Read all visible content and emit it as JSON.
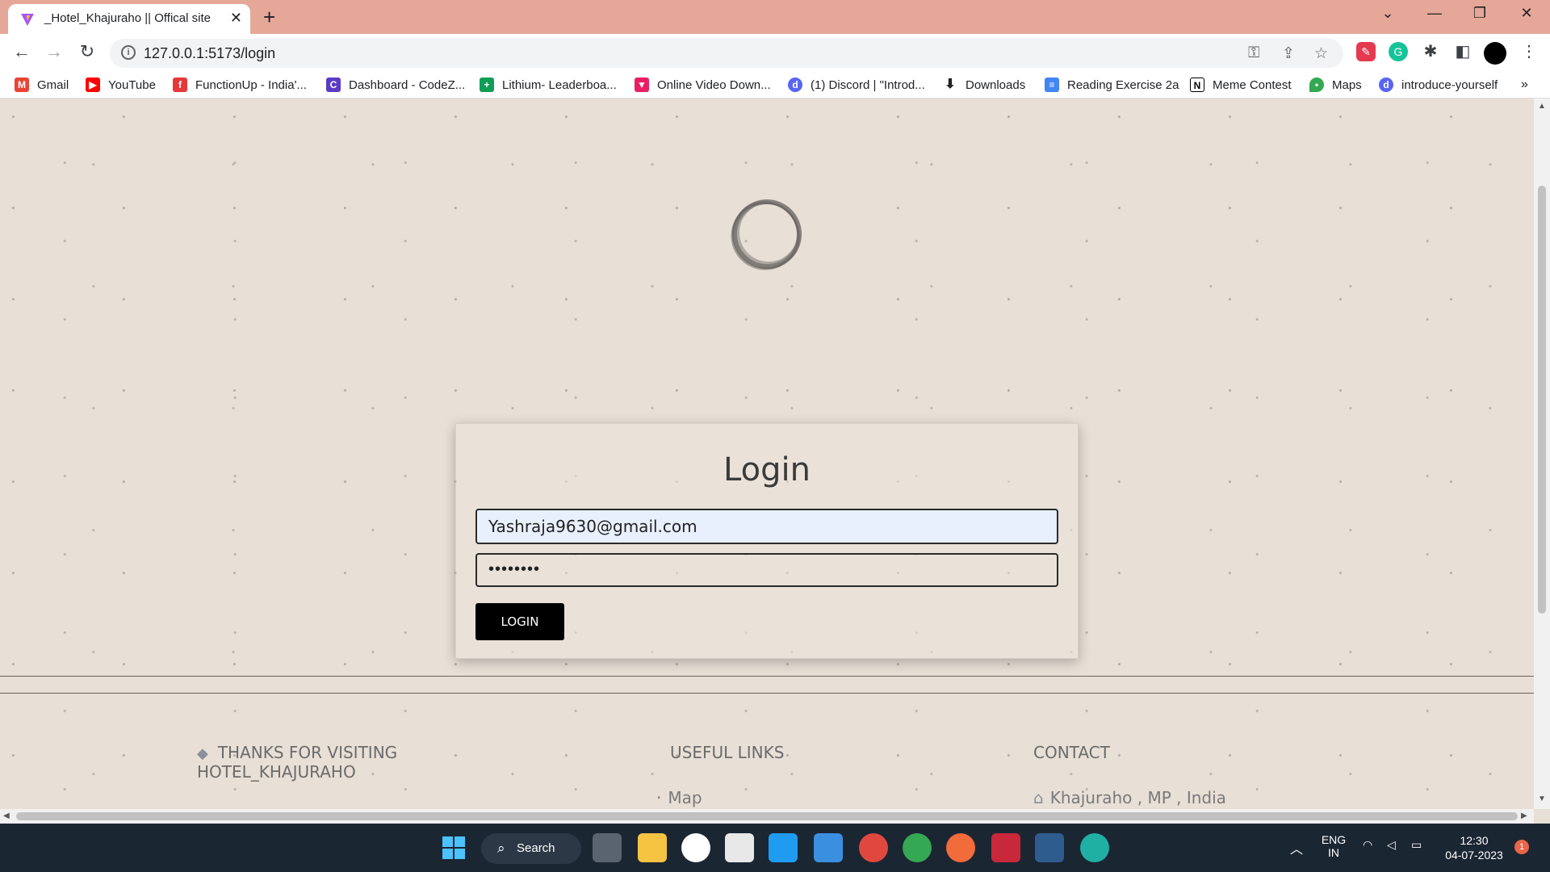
{
  "tab": {
    "title": "_Hotel_Khajuraho || Offical site"
  },
  "address_bar": {
    "url": "127.0.0.1:5173/login"
  },
  "bookmarks": [
    {
      "label": "Gmail",
      "icon": "gmail-icon",
      "color": "#ea4335"
    },
    {
      "label": "YouTube",
      "icon": "youtube-icon",
      "color": "#ff0000"
    },
    {
      "label": "FunctionUp - India'...",
      "icon": "functionup-icon",
      "color": "#e5383b"
    },
    {
      "label": "Dashboard - CodeZ...",
      "icon": "codez-icon",
      "color": "#5b3cc4"
    },
    {
      "label": "Lithium- Leaderboa...",
      "icon": "sheets-icon",
      "color": "#0f9d58"
    },
    {
      "label": "Online Video Down...",
      "icon": "video-icon",
      "color": "#e91e63"
    },
    {
      "label": "(1) Discord | \"Introd...",
      "icon": "discord-icon",
      "color": "#5865f2"
    },
    {
      "label": "Downloads",
      "icon": "download-icon",
      "color": "#202124"
    },
    {
      "label": "Reading Exercise 2a",
      "icon": "docs-icon",
      "color": "#4285f4"
    },
    {
      "label": "Meme Contest",
      "icon": "notion-icon",
      "color": "#000000"
    },
    {
      "label": "Maps",
      "icon": "maps-icon",
      "color": "#34a853"
    },
    {
      "label": "introduce-yourself",
      "icon": "discord-icon",
      "color": "#5865f2"
    }
  ],
  "login": {
    "title": "Login",
    "email_value": "Yashraja9630@gmail.com",
    "password_value": "••••••••",
    "button_label": "LOGIN"
  },
  "footer": {
    "thanks_line1": "THANKS FOR VISITING",
    "thanks_line2": "HOTEL_KHAJURAHO",
    "useful_links_title": "USEFUL LINKS",
    "useful_link_1": "Map",
    "contact_title": "CONTACT",
    "contact_address": "Khajuraho , MP , India"
  },
  "taskbar": {
    "search_label": "Search",
    "lang_line1": "ENG",
    "lang_line2": "IN",
    "time": "12:30",
    "date": "04-07-2023",
    "notification_count": "1"
  }
}
